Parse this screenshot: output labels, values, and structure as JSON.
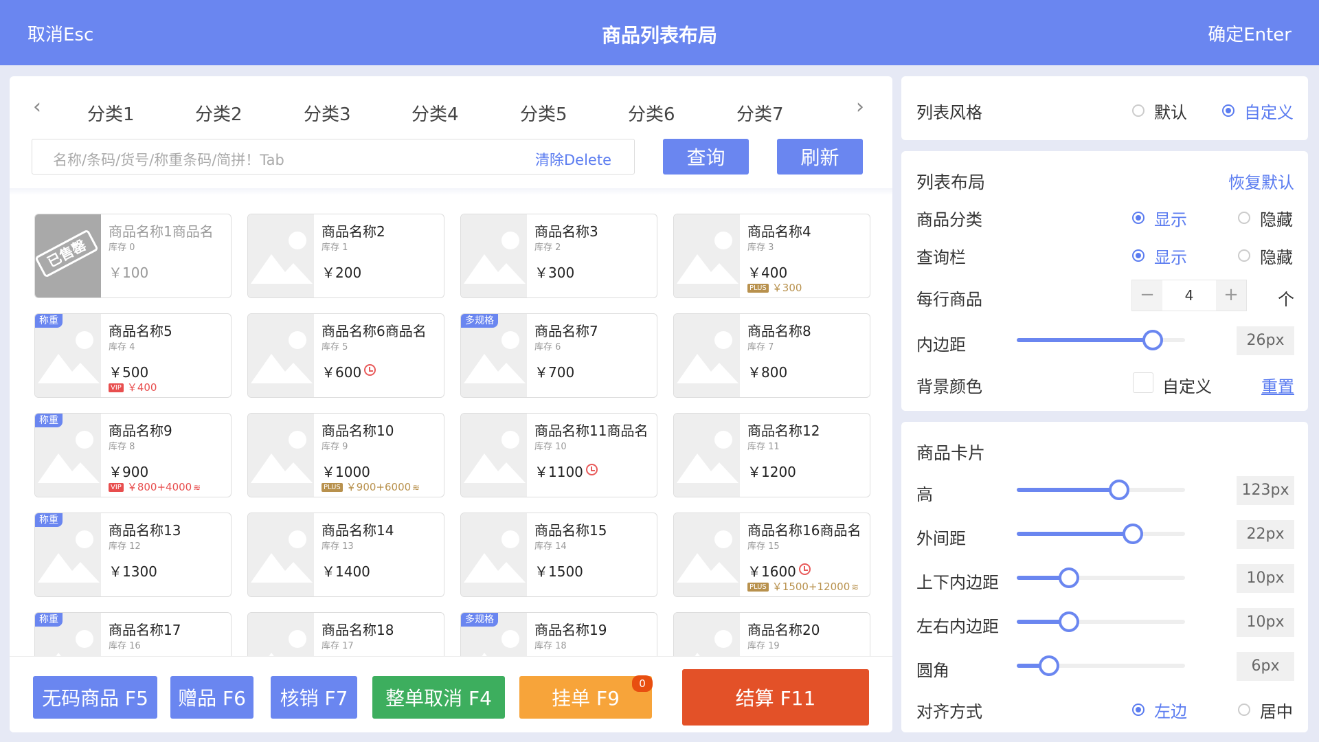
{
  "header": {
    "cancel": "取消Esc",
    "title": "商品列表布局",
    "confirm": "确定Enter"
  },
  "categories": [
    "分类1",
    "分类2",
    "分类3",
    "分类4",
    "分类5",
    "分类6",
    "分类7"
  ],
  "search": {
    "placeholder": "名称/条码/货号/称重条码/简拼！Tab",
    "clear": "清除Delete",
    "query": "查询",
    "refresh": "刷新"
  },
  "products": [
    {
      "name": "商品名称1商品名",
      "stock": "库存 0",
      "price": "￥100",
      "sold": true,
      "sold_label": "已售罄"
    },
    {
      "name": "商品名称2",
      "stock": "库存 1",
      "price": "￥200"
    },
    {
      "name": "商品名称3",
      "stock": "库存 2",
      "price": "￥300"
    },
    {
      "name": "商品名称4",
      "stock": "库存 3",
      "price": "￥400",
      "member": {
        "type": "plus",
        "badge": "PLUS",
        "price": "￥300"
      }
    },
    {
      "name": "商品名称5",
      "stock": "库存 4",
      "price": "￥500",
      "tag": "称重",
      "member": {
        "type": "vip",
        "badge": "VIP",
        "price": "￥400"
      }
    },
    {
      "name": "商品名称6商品名",
      "stock": "库存 5",
      "price": "￥600",
      "clock": true
    },
    {
      "name": "商品名称7",
      "stock": "库存 6",
      "price": "￥700",
      "tag": "多规格"
    },
    {
      "name": "商品名称8",
      "stock": "库存 7",
      "price": "￥800"
    },
    {
      "name": "商品名称9",
      "stock": "库存 8",
      "price": "￥900",
      "tag": "称重",
      "member": {
        "type": "vip",
        "badge": "VIP",
        "price": "￥800+4000",
        "coin": true
      }
    },
    {
      "name": "商品名称10",
      "stock": "库存 9",
      "price": "￥1000",
      "member": {
        "type": "plus",
        "badge": "PLUS",
        "price": "￥900+6000",
        "coin": true
      }
    },
    {
      "name": "商品名称11商品名",
      "stock": "库存 10",
      "price": "￥1100",
      "clock": true
    },
    {
      "name": "商品名称12",
      "stock": "库存 11",
      "price": "￥1200"
    },
    {
      "name": "商品名称13",
      "stock": "库存 12",
      "price": "￥1300",
      "tag": "称重"
    },
    {
      "name": "商品名称14",
      "stock": "库存 13",
      "price": "￥1400"
    },
    {
      "name": "商品名称15",
      "stock": "库存 14",
      "price": "￥1500"
    },
    {
      "name": "商品名称16商品名",
      "stock": "库存 15",
      "price": "￥1600",
      "clock": true,
      "member": {
        "type": "plus",
        "badge": "PLUS",
        "price": "￥1500+12000",
        "coin": true
      }
    },
    {
      "name": "商品名称17",
      "stock": "库存 16",
      "price": "",
      "tag": "称重"
    },
    {
      "name": "商品名称18",
      "stock": "库存 17",
      "price": ""
    },
    {
      "name": "商品名称19",
      "stock": "库存 18",
      "price": "",
      "tag": "多规格"
    },
    {
      "name": "商品名称20",
      "stock": "库存 19",
      "price": ""
    }
  ],
  "footer": {
    "buttons": [
      {
        "label": "无码商品 F5",
        "color": "#6a86f0"
      },
      {
        "label": "赠品 F6",
        "color": "#6a86f0"
      },
      {
        "label": "核销 F7",
        "color": "#6a86f0"
      },
      {
        "label": "整单取消 F4",
        "color": "#3dae5e"
      },
      {
        "label": "挂单 F9",
        "color": "#f7a43a",
        "badge": "0"
      },
      {
        "label": "结算 F11",
        "color": "#e35128"
      }
    ]
  },
  "settings": {
    "style": {
      "label": "列表风格",
      "default": "默认",
      "custom": "自定义",
      "selected": "custom"
    },
    "layout": {
      "title": "列表布局",
      "reset_default": "恢复默认",
      "category": {
        "label": "商品分类",
        "show": "显示",
        "hide": "隐藏",
        "selected": "show"
      },
      "searchbar": {
        "label": "查询栏",
        "show": "显示",
        "hide": "隐藏",
        "selected": "show"
      },
      "per_row": {
        "label": "每行商品",
        "value": "4",
        "unit": "个",
        "minus": "−",
        "plus": "+"
      },
      "padding": {
        "label": "内边距",
        "value": "26px",
        "fraction": 0.81
      },
      "bg": {
        "label": "背景颜色",
        "custom": "自定义",
        "reset": "重置"
      }
    },
    "card": {
      "title": "商品卡片",
      "height": {
        "label": "高",
        "value": "123px",
        "fraction": 0.61
      },
      "margin": {
        "label": "外间距",
        "value": "22px",
        "fraction": 0.69
      },
      "padding_v": {
        "label": "上下内边距",
        "value": "10px",
        "fraction": 0.31
      },
      "padding_h": {
        "label": "左右内边距",
        "value": "10px",
        "fraction": 0.31
      },
      "radius": {
        "label": "圆角",
        "value": "6px",
        "fraction": 0.19
      },
      "align": {
        "label": "对齐方式",
        "left": "左边",
        "center": "居中",
        "selected": "left"
      }
    }
  }
}
